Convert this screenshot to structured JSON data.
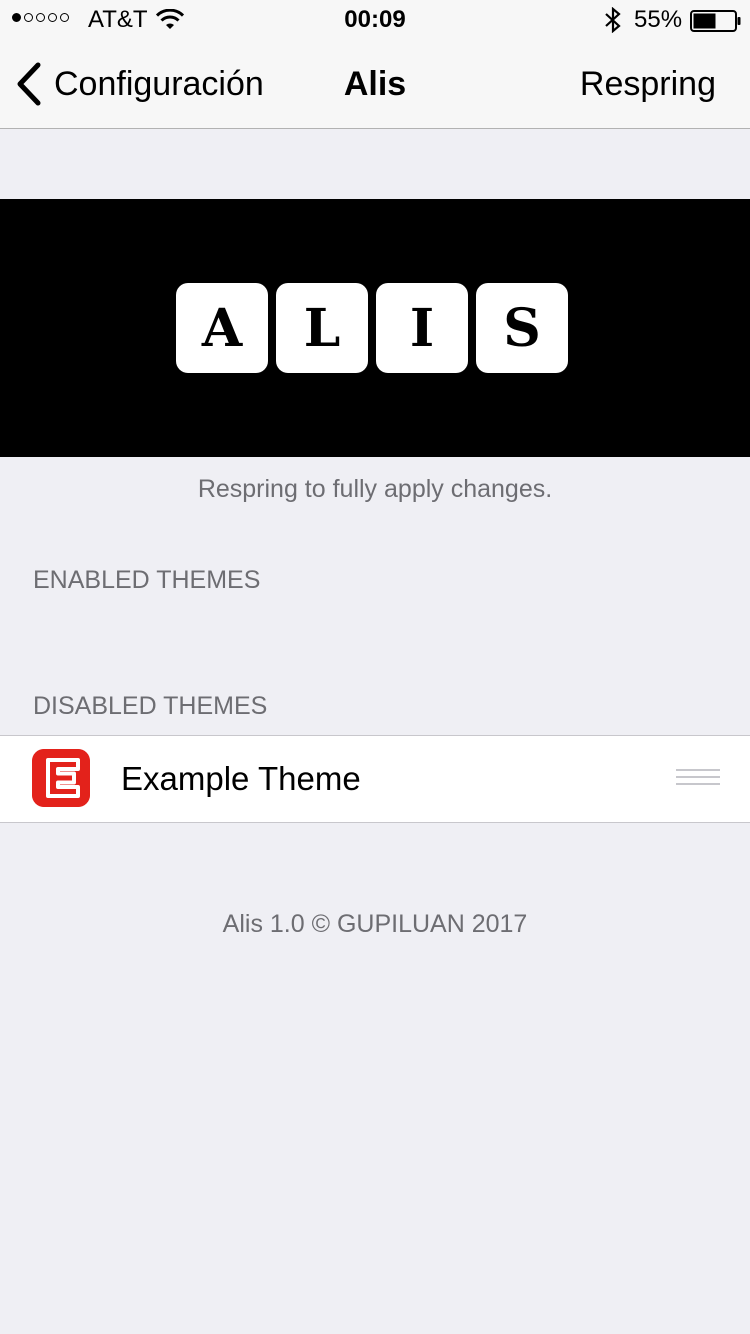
{
  "status_bar": {
    "signal_dots": [
      true,
      false,
      false,
      false,
      false
    ],
    "carrier": "AT&T",
    "time": "00:09",
    "battery_percent": "55%",
    "battery_level": 0.55,
    "icons": [
      "wifi-icon",
      "bluetooth-icon",
      "battery-icon"
    ]
  },
  "nav": {
    "back_label": "Configuración",
    "title": "Alis",
    "right_button": "Respring",
    "back_icon": "chevron-left-icon"
  },
  "banner": {
    "logo_letters": [
      "A",
      "L",
      "I",
      "S"
    ],
    "footer": "Respring to fully apply changes."
  },
  "sections": {
    "enabled": {
      "header": "ENABLED THEMES",
      "items": []
    },
    "disabled": {
      "header": "DISABLED THEMES",
      "items": [
        {
          "label": "Example Theme",
          "icon": "letter-e-theme-icon",
          "icon_color": "#e3221b"
        }
      ]
    }
  },
  "footer": "Alis 1.0 © GUPILUAN 2017"
}
